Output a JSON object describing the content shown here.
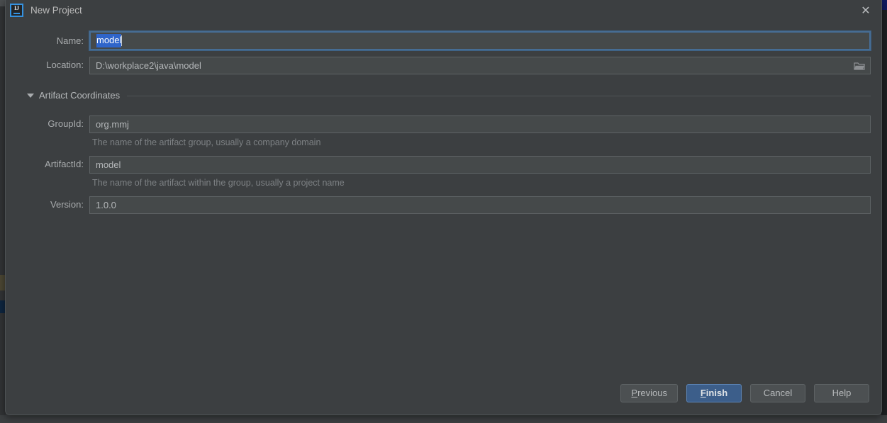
{
  "window": {
    "title": "New Project",
    "app_icon": "intellij-idea-icon",
    "icon_text": "IJ",
    "close_icon": "close-icon",
    "close_glyph": "✕",
    "accent_color": "#3592e0",
    "background_color": "#3c3f41"
  },
  "form": {
    "name": {
      "label": "Name:",
      "value": "model",
      "selected": true,
      "focused": true,
      "selection_color": "#2f65ca",
      "focus_border_color": "#466d94"
    },
    "location": {
      "label": "Location:",
      "value": "D:\\workplace2\\java\\model",
      "browse_icon": "folder-icon"
    }
  },
  "section": {
    "title": "Artifact Coordinates",
    "expanded": true,
    "toggle_icon": "chevron-down-icon",
    "fields": [
      {
        "key": "groupid",
        "label": "GroupId:",
        "value": "org.mmj",
        "hint": "The name of the artifact group, usually a company domain"
      },
      {
        "key": "artifactid",
        "label": "ArtifactId:",
        "value": "model",
        "hint": "The name of the artifact within the group, usually a project name"
      },
      {
        "key": "version",
        "label": "Version:",
        "value": "1.0.0",
        "hint": ""
      }
    ]
  },
  "footer": {
    "buttons": [
      {
        "id": "previous",
        "label": "Previous",
        "mnemonic": "P",
        "default": false
      },
      {
        "id": "finish",
        "label": "Finish",
        "mnemonic": "F",
        "default": true
      },
      {
        "id": "cancel",
        "label": "Cancel",
        "mnemonic": "",
        "default": false
      },
      {
        "id": "help",
        "label": "Help",
        "mnemonic": "",
        "default": false
      }
    ],
    "default_button_color": "#3c5e8a"
  }
}
